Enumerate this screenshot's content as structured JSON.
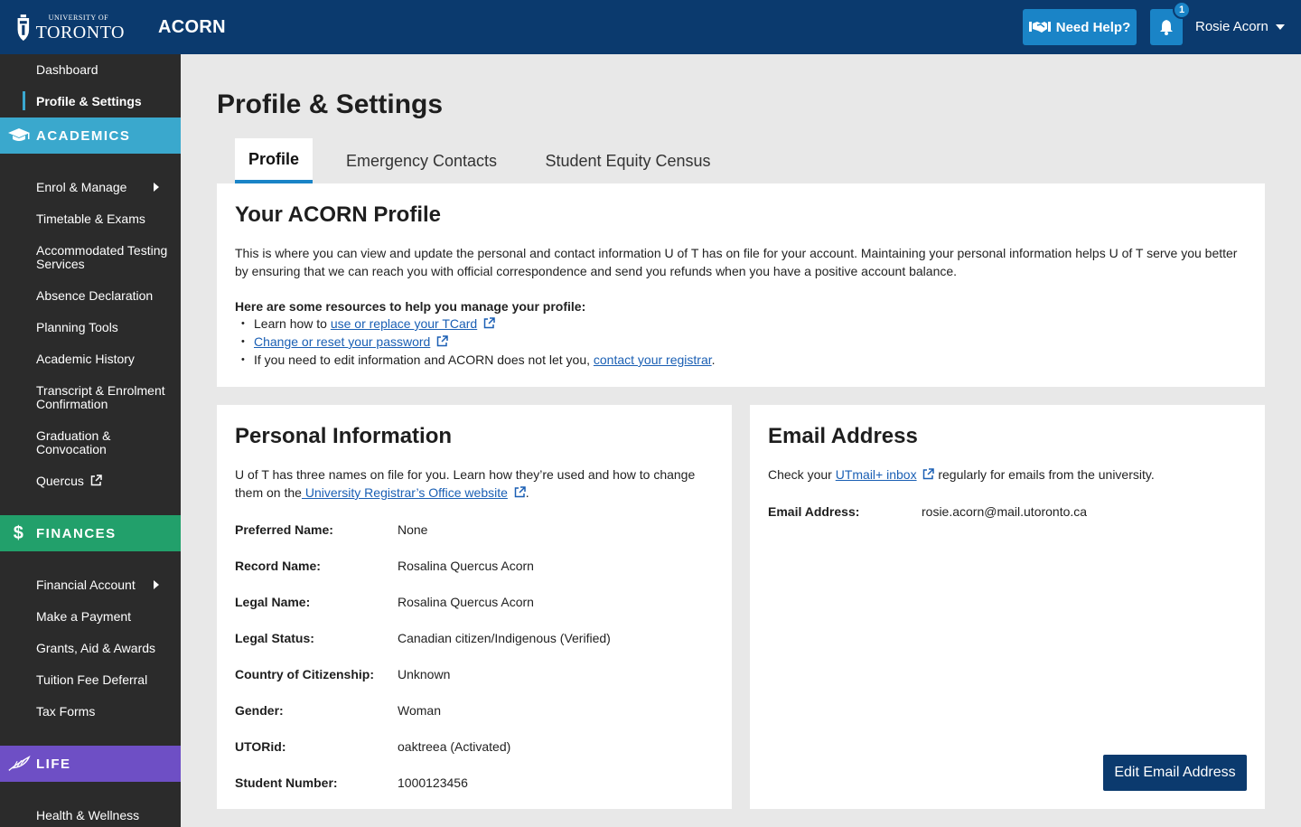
{
  "header": {
    "logo_small": "UNIVERSITY OF",
    "logo_big": "TORONTO",
    "app_title": "ACORN",
    "help_label": "Need Help?",
    "notification_count": "1",
    "user_name": "Rosie Acorn"
  },
  "sidebar": {
    "top_items": [
      "Dashboard",
      "Profile & Settings"
    ],
    "academics_label": "ACADEMICS",
    "academics_items": [
      "Enrol & Manage",
      "Timetable & Exams",
      "Accommodated Testing Services",
      "Absence Declaration",
      "Planning Tools",
      "Academic History",
      "Transcript & Enrolment Confirmation",
      "Graduation & Convocation",
      "Quercus"
    ],
    "finances_label": "FINANCES",
    "finances_items": [
      "Financial Account",
      "Make a Payment",
      "Grants, Aid & Awards",
      "Tuition Fee Deferral",
      "Tax Forms"
    ],
    "life_label": "LIFE",
    "life_items": [
      "Health & Wellness"
    ]
  },
  "main": {
    "page_title": "Profile & Settings",
    "tabs": [
      "Profile",
      "Emergency Contacts",
      "Student Equity Census"
    ]
  },
  "profile_card": {
    "title": "Your ACORN Profile",
    "intro": "This is where you can view and update the personal and contact information U of T has on file for your account. Maintaining your personal information helps U of T serve you better by ensuring that we can reach you with official correspondence and send you refunds when you have a positive account balance.",
    "resources_heading": "Here are some resources to help you manage your profile:",
    "r1_prefix": "Learn how to ",
    "r1_link": "use or replace your TCard",
    "r2_link": "Change or reset your password",
    "r3_prefix": "If you need to edit information and ACORN does not let you, ",
    "r3_link": "contact your registrar",
    "r3_suffix": "."
  },
  "personal_card": {
    "title": "Personal Information",
    "intro_prefix": "U of T has three names on file for you. Learn how they’re used and how to change them on the",
    "intro_link": " University Registrar’s Office website",
    "intro_suffix": ".",
    "rows": [
      {
        "label": "Preferred Name:",
        "value": "None"
      },
      {
        "label": "Record Name:",
        "value": "Rosalina Quercus Acorn"
      },
      {
        "label": "Legal Name:",
        "value": "Rosalina Quercus Acorn"
      },
      {
        "label": "Legal Status:",
        "value": "Canadian citizen/Indigenous (Verified)"
      },
      {
        "label": "Country of Citizenship:",
        "value": "Unknown"
      },
      {
        "label": "Gender:",
        "value": "Woman"
      },
      {
        "label": "UTORid:",
        "value": "oaktreea (Activated)"
      },
      {
        "label": "Student Number:",
        "value": "1000123456"
      }
    ]
  },
  "email_card": {
    "title": "Email Address",
    "check_prefix": "Check your ",
    "check_link": "UTmail+ inbox",
    "check_suffix": " regularly for emails from the university.",
    "label": "Email Address:",
    "value": "rosie.acorn@mail.utoronto.ca",
    "edit_button": "Edit Email Address"
  },
  "colors": {
    "header_bg": "#0b3a6e",
    "sidebar_bg": "#2b2b2b",
    "academics": "#3aa8cd",
    "finances": "#22a06b",
    "life": "#6e4fc5",
    "accent": "#1a84c7",
    "link": "#1a5fb4"
  },
  "icons": [
    "uoft-crest-icon",
    "handshake-icon",
    "bell-icon",
    "caret-down-icon",
    "graduation-cap-icon",
    "dollar-icon",
    "feather-icon",
    "external-link-icon",
    "chevron-right-icon"
  ]
}
